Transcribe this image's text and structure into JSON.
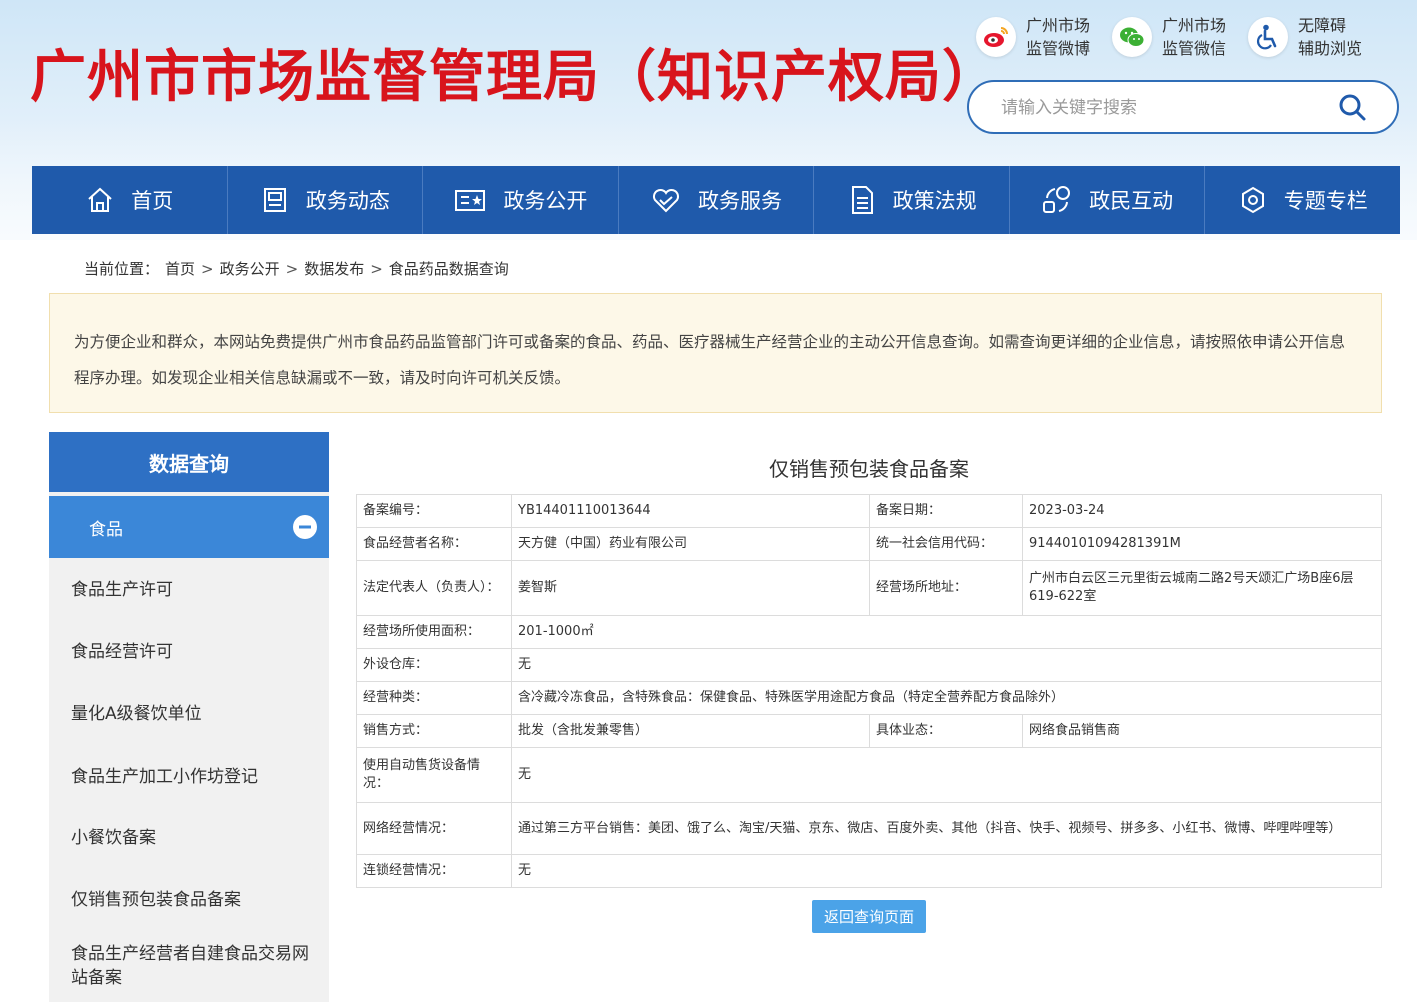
{
  "header": {
    "site_title": "广州市市场监督管理局（知识产权局）",
    "quick_links": [
      {
        "label_line1": "广州市场",
        "label_line2": "监管微博",
        "icon": "weibo-icon"
      },
      {
        "label_line1": "广州市场",
        "label_line2": "监管微信",
        "icon": "wechat-icon"
      },
      {
        "label_line1": "无障碍",
        "label_line2": "辅助浏览",
        "icon": "accessibility-icon"
      }
    ],
    "search": {
      "placeholder": "请输入关键字搜索",
      "icon": "search-icon"
    }
  },
  "nav": {
    "items": [
      {
        "label": "首页",
        "icon": "home-icon"
      },
      {
        "label": "政务动态",
        "icon": "document-box-icon"
      },
      {
        "label": "政务公开",
        "icon": "id-card-icon"
      },
      {
        "label": "政务服务",
        "icon": "heart-icon"
      },
      {
        "label": "政策法规",
        "icon": "file-text-icon"
      },
      {
        "label": "政民互动",
        "icon": "interaction-icon"
      },
      {
        "label": "专题专栏",
        "icon": "gear-icon"
      }
    ]
  },
  "breadcrumb": {
    "prefix": "当前位置：",
    "items": [
      "首页",
      "政务公开",
      "数据发布",
      "食品药品数据查询"
    ],
    "separator": ">"
  },
  "notice": {
    "text": "为方便企业和群众，本网站免费提供广州市食品药品监管部门许可或备案的食品、药品、医疗器械生产经营企业的主动公开信息查询。如需查询更详细的企业信息，请按照依申请公开信息程序办理。如发现企业相关信息缺漏或不一致，请及时向许可机关反馈。"
  },
  "sidebar": {
    "title": "数据查询",
    "active": "食品",
    "items": [
      "食品生产许可",
      "食品经营许可",
      "量化A级餐饮单位",
      "食品生产加工小作坊登记",
      "小餐饮备案",
      "仅销售预包装食品备案",
      "食品生产经营者自建食品交易网站备案"
    ]
  },
  "detail": {
    "title": "仅销售预包装食品备案",
    "rows": {
      "record_no": {
        "label": "备案编号：",
        "value": "YB14401110013644"
      },
      "record_date": {
        "label": "备案日期：",
        "value": "2023-03-24"
      },
      "operator_name": {
        "label": "食品经营者名称：",
        "value": "天方健（中国）药业有限公司"
      },
      "credit_code": {
        "label": "统一社会信用代码：",
        "value": "91440101094281391M"
      },
      "legal_rep": {
        "label": "法定代表人（负责人）：",
        "value": "姜智斯"
      },
      "address": {
        "label": "经营场所地址：",
        "value": "广州市白云区三元里街云城南二路2号天颂汇广场B座6层619-622室"
      },
      "area": {
        "label": "经营场所使用面积：",
        "value": "201-1000㎡"
      },
      "warehouse": {
        "label": "外设仓库：",
        "value": "无"
      },
      "category": {
        "label": "经营种类：",
        "value": "含冷藏冷冻食品，含特殊食品：保健食品、特殊医学用途配方食品（特定全营养配方食品除外）"
      },
      "sales_mode": {
        "label": "销售方式：",
        "value": "批发（含批发兼零售）"
      },
      "business_type": {
        "label": "具体业态：",
        "value": "网络食品销售商"
      },
      "vending": {
        "label": "使用自动售货设备情况：",
        "value": "无"
      },
      "online": {
        "label": "网络经营情况：",
        "value": "通过第三方平台销售：美团、饿了么、淘宝/天猫、京东、微店、百度外卖、其他（抖音、快手、视频号、拼多多、小红书、微博、哔哩哔哩等）"
      },
      "chain": {
        "label": "连锁经营情况：",
        "value": "无"
      }
    },
    "back_button": "返回查询页面"
  },
  "colors": {
    "title_red": "#d8141c",
    "nav_blue": "#1f5aab",
    "sidebar_head": "#2e70c4",
    "sidebar_active": "#3b87d8",
    "notice_bg": "#fdf8e8",
    "button_blue": "#4ba3e8"
  }
}
